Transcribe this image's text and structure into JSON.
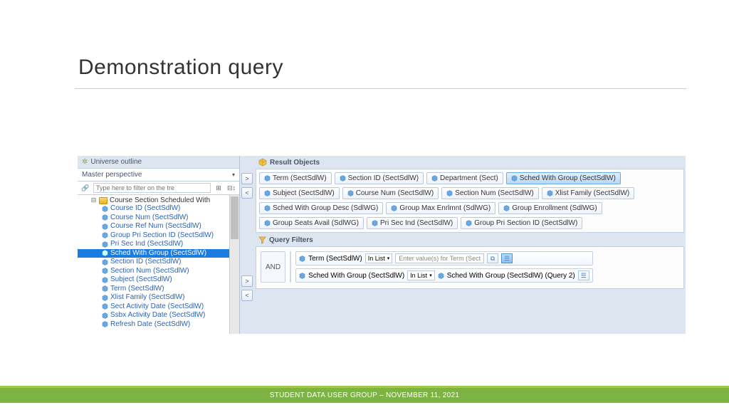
{
  "slide": {
    "title": "Demonstration query"
  },
  "footer": "STUDENT DATA USER GROUP – NOVEMBER 11, 2021",
  "sidebar": {
    "header": "Universe outline",
    "perspective": "Master perspective",
    "filter_placeholder": "Type here to filter on the tre",
    "folder": "Course Section Scheduled With",
    "items": [
      "Course ID (SectSdlW)",
      "Course Num (SectSdlW)",
      "Course Ref Num (SectSdlW)",
      "Group Pri Section ID (SectSdlW)",
      "Pri Sec Ind (SectSdlW)",
      "Sched With Group (SectSdlW)",
      "Section ID (SectSdlW)",
      "Section Num (SectSdlW)",
      "Subject (SectSdlW)",
      "Term (SectSdlW)",
      "Xlist Family (SectSdlW)",
      "Sect Activity Date (SectSdlW)",
      "Ssbx Activity Date (SectSdlW)",
      "Refresh Date (SectSdlW)"
    ],
    "selected_index": 5
  },
  "result": {
    "header": "Result Objects",
    "chips": [
      {
        "label": "Term (SectSdlW)",
        "hl": false
      },
      {
        "label": "Section ID (SectSdlW)",
        "hl": false
      },
      {
        "label": "Department (Sect)",
        "hl": false
      },
      {
        "label": "Sched With Group (SectSdlW)",
        "hl": true
      },
      {
        "label": "Subject (SectSdlW)",
        "hl": false
      },
      {
        "label": "Course Num (SectSdlW)",
        "hl": false
      },
      {
        "label": "Section Num (SectSdlW)",
        "hl": false
      },
      {
        "label": "Xlist Family (SectSdlW)",
        "hl": false
      },
      {
        "label": "Sched With Group Desc (SdlWG)",
        "hl": false
      },
      {
        "label": "Group Max Enrlmnt (SdlWG)",
        "hl": false
      },
      {
        "label": "Group Enrollment (SdlWG)",
        "hl": false
      },
      {
        "label": "Group Seats Avail (SdlWG)",
        "hl": false
      },
      {
        "label": "Pri Sec Ind (SectSdlW)",
        "hl": false
      },
      {
        "label": "Group Pri Section ID (SectSdlW)",
        "hl": false
      }
    ]
  },
  "filters": {
    "header": "Query Filters",
    "and_label": "AND",
    "rows": [
      {
        "field": "Term (SectSdlW)",
        "op": "In List",
        "value_placeholder": "Enter value(s) for Term (Sect"
      },
      {
        "field": "Sched With Group (SectSdlW)",
        "op": "In List",
        "value_field": "Sched With Group (SectSdlW) (Query 2)"
      }
    ]
  }
}
